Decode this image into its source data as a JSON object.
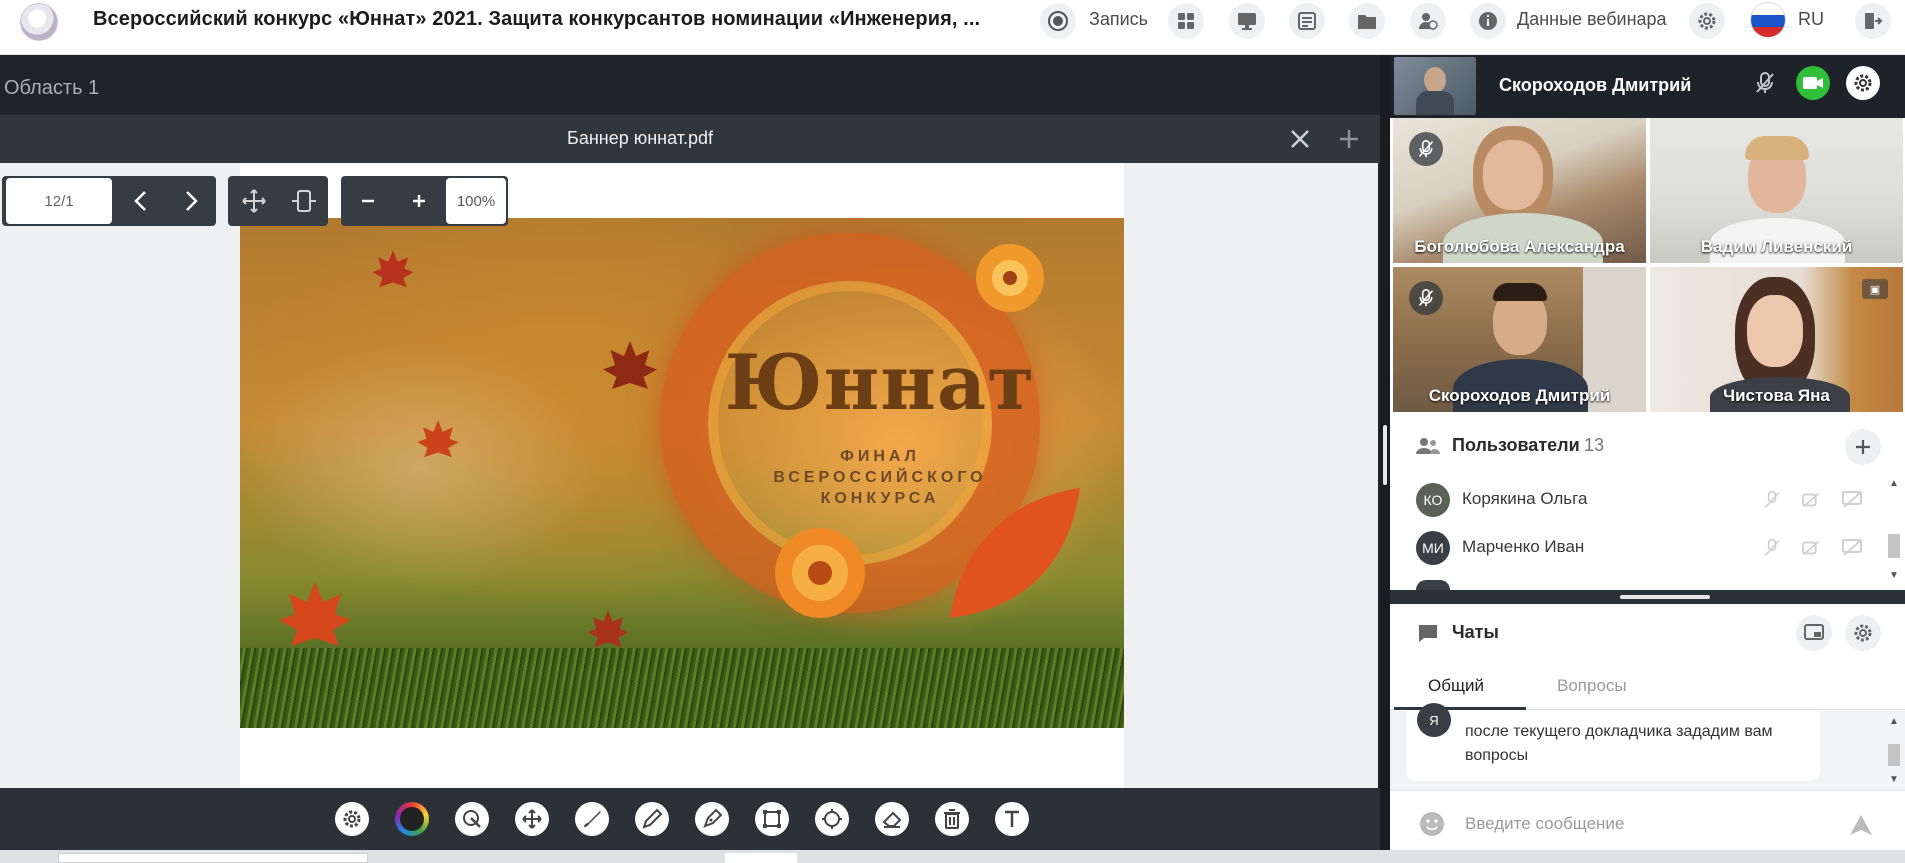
{
  "header": {
    "title": "Всероссийский конкурс «Юннат» 2021. Защита конкурсантов номинации «Инженерия, ...",
    "record_label": "Запись",
    "webinar_data_label": "Данные вебинара",
    "language": "RU"
  },
  "workspace": {
    "area_label": "Область 1",
    "document_title": "Баннер юннат.pdf",
    "page_indicator": "12/1",
    "zoom": "100%",
    "banner": {
      "brand": "Юннат",
      "subtitle_line1": "ФИНАЛ",
      "subtitle_line2": "ВСЕРОССИЙСКОГО",
      "subtitle_line3": "КОНКУРСА"
    }
  },
  "video": {
    "speaker": "Скороходов Дмитрий",
    "tiles": [
      {
        "name": "Боголюбова Александра",
        "muted": true
      },
      {
        "name": "Вадим Ливенский",
        "muted": false
      },
      {
        "name": "Скороходов Дмитрий",
        "muted": true
      },
      {
        "name": "Чистова Яна",
        "muted": false
      }
    ]
  },
  "users": {
    "title": "Пользователи",
    "count": "13",
    "list": [
      {
        "initials": "КО",
        "name": "Корякина Ольга"
      },
      {
        "initials": "МИ",
        "name": "Марченко Иван"
      }
    ]
  },
  "chat": {
    "title": "Чаты",
    "tabs": [
      "Общий",
      "Вопросы"
    ],
    "message_avatar": "Я",
    "message_text": "после текущего докладчика зададим вам вопросы",
    "input_placeholder": "Введите сообщение"
  },
  "colors": {
    "work_bg": "#1f2428",
    "accent_green": "#2fbf3a"
  }
}
